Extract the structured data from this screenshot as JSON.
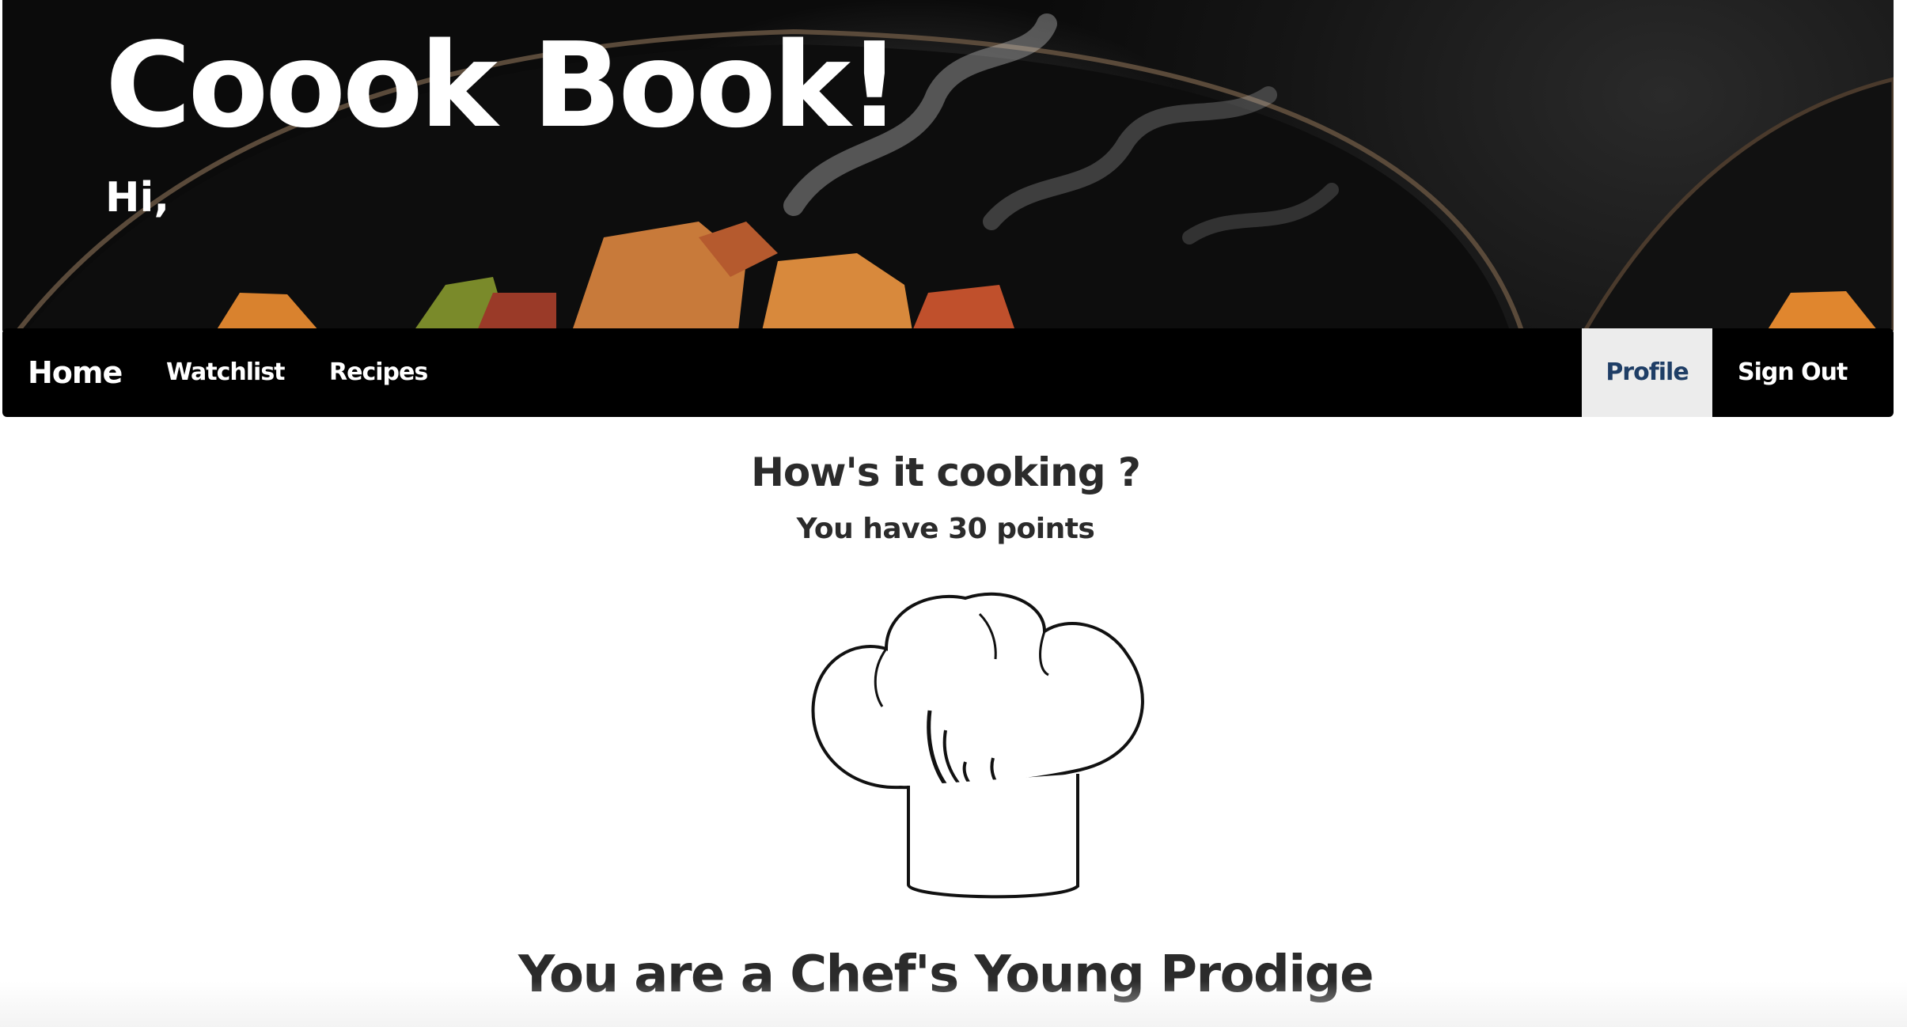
{
  "hero": {
    "title": "Coook Book!",
    "greeting": "Hi,"
  },
  "nav": {
    "home": "Home",
    "watchlist": "Watchlist",
    "recipes": "Recipes",
    "profile": "Profile",
    "sign_out": "Sign Out",
    "active_item": "Profile"
  },
  "main": {
    "greeting_heading": "How's it cooking ?",
    "points_text": "You have 30 points",
    "badge_icon": "chef-hat-icon",
    "rank_text": "You are a Chef's Young Prodige"
  },
  "colors": {
    "nav_background": "#000000",
    "nav_text": "#ffffff",
    "active_tab_background": "#ececec",
    "active_tab_text": "#1f3e66",
    "heading_text": "#2b2b2b"
  }
}
